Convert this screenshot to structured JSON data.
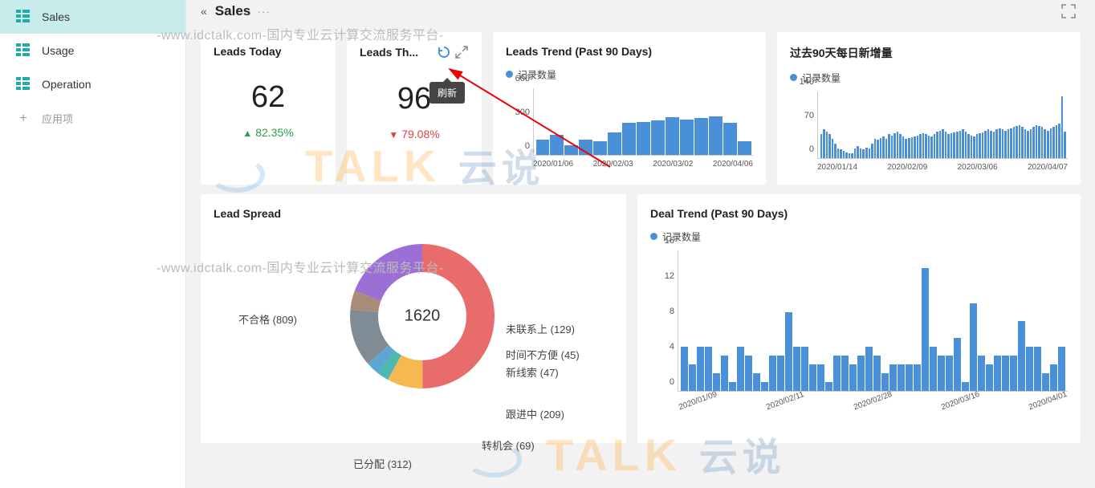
{
  "sidebar": {
    "items": [
      {
        "label": "Sales",
        "active": true
      },
      {
        "label": "Usage",
        "active": false
      },
      {
        "label": "Operation",
        "active": false
      }
    ],
    "add_label": "应用项"
  },
  "header": {
    "collapse": "«",
    "title": "Sales",
    "dots": "···"
  },
  "watermarks": {
    "text": "-www.idctalk.com-国内专业云计算交流服务平台-",
    "brand": "TALK",
    "brand_cn": "云说"
  },
  "tooltip": "刷新",
  "kpi1": {
    "title": "Leads Today",
    "value": "62",
    "pct": "82.35%",
    "dir": "up"
  },
  "kpi2": {
    "title": "Leads Th...",
    "value": "96",
    "pct": "79.08%",
    "dir": "down"
  },
  "chart1": {
    "title": "Leads Trend (Past 90 Days)",
    "legend": "记录数量"
  },
  "chart2": {
    "title": "过去90天每日新增量",
    "legend": "记录数量"
  },
  "chart3": {
    "title": "Lead Spread",
    "center": "1620"
  },
  "chart4": {
    "title": "Deal Trend (Past 90 Days)",
    "legend": "记录数量"
  },
  "chart_data": [
    {
      "type": "bar",
      "title": "Leads Trend (Past 90 Days)",
      "legend": [
        "记录数量"
      ],
      "ylim": [
        0,
        600
      ],
      "yticks": [
        0,
        300,
        600
      ],
      "x_labels": [
        "2020/01/06",
        "2020/02/03",
        "2020/03/02",
        "2020/04/06"
      ],
      "values": [
        140,
        180,
        90,
        140,
        120,
        200,
        290,
        300,
        310,
        340,
        320,
        330,
        350,
        290,
        120
      ]
    },
    {
      "type": "bar",
      "title": "过去90天每日新增量",
      "legend": [
        "记录数量"
      ],
      "ylim": [
        0,
        140
      ],
      "yticks": [
        0,
        70,
        140
      ],
      "x_labels": [
        "2020/01/14",
        "2020/02/09",
        "2020/03/06",
        "2020/04/07"
      ],
      "values": [
        50,
        60,
        55,
        50,
        40,
        30,
        20,
        18,
        15,
        12,
        10,
        10,
        20,
        25,
        20,
        18,
        22,
        20,
        30,
        40,
        38,
        42,
        45,
        40,
        50,
        48,
        52,
        55,
        50,
        45,
        40,
        42,
        44,
        46,
        48,
        50,
        52,
        50,
        48,
        46,
        50,
        55,
        58,
        60,
        55,
        50,
        52,
        54,
        56,
        58,
        60,
        55,
        50,
        48,
        46,
        50,
        52,
        54,
        58,
        60,
        58,
        55,
        60,
        62,
        60,
        58,
        60,
        62,
        65,
        68,
        70,
        65,
        60,
        58,
        60,
        65,
        70,
        68,
        65,
        60,
        58,
        62,
        66,
        70,
        72,
        130,
        55
      ]
    },
    {
      "type": "pie",
      "title": "Lead Spread",
      "total": 1620,
      "slices": [
        {
          "label": "不合格",
          "value": 809,
          "color": "#e86c6c"
        },
        {
          "label": "未联系上",
          "value": 129,
          "color": "#f5b94f"
        },
        {
          "label": "时间不方便",
          "value": 45,
          "color": "#4eb8b0"
        },
        {
          "label": "新线索",
          "value": 47,
          "color": "#5aa7d6"
        },
        {
          "label": "跟进中",
          "value": 209,
          "color": "#7f8c96"
        },
        {
          "label": "转机会",
          "value": 69,
          "color": "#a88b78"
        },
        {
          "label": "已分配",
          "value": 312,
          "color": "#9c6fd6"
        }
      ]
    },
    {
      "type": "bar",
      "title": "Deal Trend (Past 90 Days)",
      "legend": [
        "记录数量"
      ],
      "ylim": [
        0,
        16
      ],
      "yticks": [
        0,
        4,
        8,
        12,
        16
      ],
      "x_labels": [
        "2020/01/09",
        "2020/02/11",
        "2020/02/28",
        "2020/03/16",
        "2020/04/01"
      ],
      "values": [
        5,
        3,
        5,
        5,
        2,
        4,
        1,
        5,
        4,
        2,
        1,
        4,
        4,
        9,
        5,
        5,
        3,
        3,
        1,
        4,
        4,
        3,
        4,
        5,
        4,
        2,
        3,
        3,
        3,
        3,
        14,
        5,
        4,
        4,
        6,
        1,
        10,
        4,
        3,
        4,
        4,
        4,
        8,
        5,
        5,
        2,
        3,
        5
      ]
    }
  ]
}
